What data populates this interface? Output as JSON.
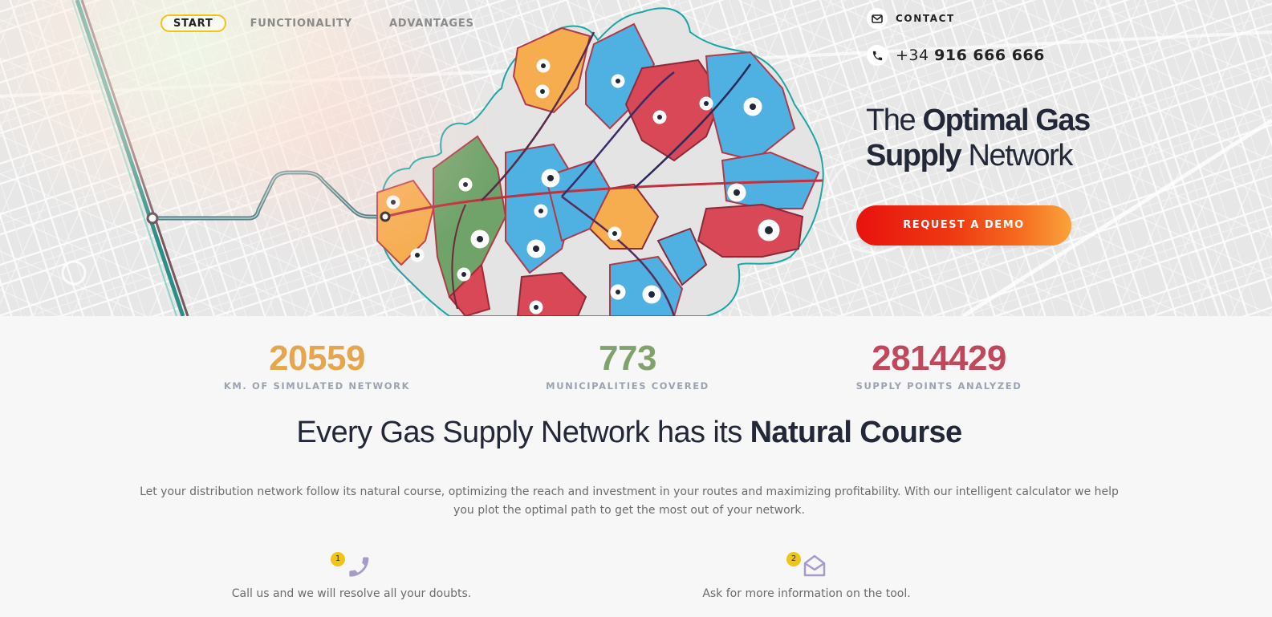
{
  "nav": {
    "items": [
      {
        "label": "START",
        "active": true
      },
      {
        "label": "FUNCTIONALITY",
        "active": false
      },
      {
        "label": "ADVANTAGES",
        "active": false
      }
    ]
  },
  "contact": {
    "label": "CONTACT",
    "phone_prefix": "+34",
    "phone_number": "916 666 666"
  },
  "hero": {
    "title_pre": "The",
    "title_bold_1": "Optimal Gas",
    "title_bold_2": "Supply",
    "title_post": "Network",
    "cta_label": "REQUEST A DEMO"
  },
  "stats": [
    {
      "value": "20559",
      "label": "KM. OF SIMULATED NETWORK",
      "color": "#e5a64e"
    },
    {
      "value": "773",
      "label": "MUNICIPALITIES COVERED",
      "color": "#7fa36a"
    },
    {
      "value": "2814429",
      "label": "SUPPLY POINTS ANALYZED",
      "color": "#c0485a"
    }
  ],
  "section": {
    "heading_light": "Every Gas Supply Network has its",
    "heading_bold": "Natural Course",
    "paragraph": "Let your distribution network follow its natural course, optimizing the reach and investment in your routes and maximizing profitability. With our intelligent calculator we help you plot the optimal path to get the most out of your network."
  },
  "features": [
    {
      "badge": "1",
      "text": "Call us and we will resolve all your doubts.",
      "icon": "phone-icon"
    },
    {
      "badge": "2",
      "text": "Ask for more information on the tool.",
      "icon": "envelope-open-icon"
    }
  ],
  "colors": {
    "accent_yellow": "#f0c419",
    "leaf_orange": "#f6ad4f",
    "leaf_green": "#6fa36a",
    "leaf_blue": "#4fb1e1",
    "leaf_red": "#d84856",
    "outline_teal": "#1aa6a6",
    "dark_text": "#232838"
  }
}
